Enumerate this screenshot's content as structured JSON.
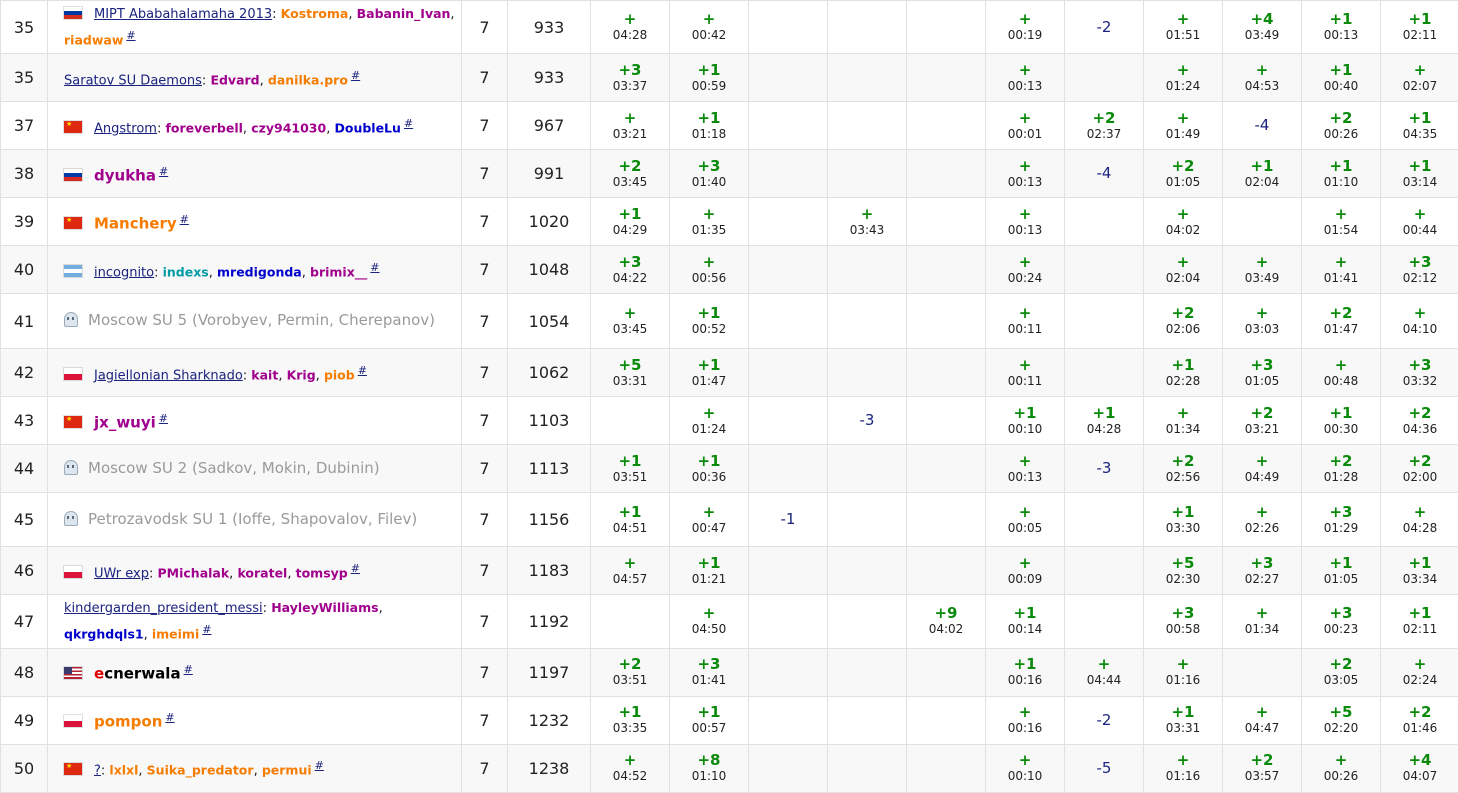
{
  "colors": {
    "accepted": "#0a8a0a",
    "rejected": "#1a237e",
    "team_link": "#1a237e",
    "orange": "#f57c00",
    "violet": "#a0008c",
    "blue": "#0000cc",
    "cyan": "#039ba6",
    "gray": "#9a9a9a"
  },
  "rows": [
    {
      "rank": "35",
      "flag": "ru",
      "team": "MIPT Ababahalamaha 2013",
      "style": "link",
      "members": [
        {
          "n": "Kostroma",
          "c": "orange"
        },
        {
          "n": "Babanin_Ivan",
          "c": "violet"
        },
        {
          "n": "riadwaw",
          "c": "orange"
        }
      ],
      "solved": "7",
      "penalty": "933",
      "cells": [
        {
          "r": "+",
          "t": "04:28"
        },
        {
          "r": "+",
          "t": "00:42"
        },
        null,
        null,
        null,
        {
          "r": "+",
          "t": "00:19"
        },
        {
          "r": "-2"
        },
        {
          "r": "+",
          "t": "01:51"
        },
        {
          "r": "+4",
          "t": "03:49"
        },
        {
          "r": "+1",
          "t": "00:13"
        },
        {
          "r": "+1",
          "t": "02:11"
        }
      ]
    },
    {
      "rank": "35",
      "flag": "",
      "team": "Saratov SU Daemons",
      "style": "link",
      "members": [
        {
          "n": "Edvard",
          "c": "violet"
        },
        {
          "n": "danilka.pro",
          "c": "orange"
        }
      ],
      "solved": "7",
      "penalty": "933",
      "cells": [
        {
          "r": "+3",
          "t": "03:37"
        },
        {
          "r": "+1",
          "t": "00:59"
        },
        null,
        null,
        null,
        {
          "r": "+",
          "t": "00:13"
        },
        null,
        {
          "r": "+",
          "t": "01:24"
        },
        {
          "r": "+",
          "t": "04:53"
        },
        {
          "r": "+1",
          "t": "00:40"
        },
        {
          "r": "+",
          "t": "02:07"
        }
      ]
    },
    {
      "rank": "37",
      "flag": "cn",
      "team": "Angstrom",
      "style": "link",
      "members": [
        {
          "n": "foreverbell",
          "c": "violet"
        },
        {
          "n": "czy941030",
          "c": "violet"
        },
        {
          "n": "DoubleLu",
          "c": "blue"
        }
      ],
      "solved": "7",
      "penalty": "967",
      "cells": [
        {
          "r": "+",
          "t": "03:21"
        },
        {
          "r": "+1",
          "t": "01:18"
        },
        null,
        null,
        null,
        {
          "r": "+",
          "t": "00:01"
        },
        {
          "r": "+2",
          "t": "02:37"
        },
        {
          "r": "+",
          "t": "01:49"
        },
        {
          "r": "-4"
        },
        {
          "r": "+2",
          "t": "00:26"
        },
        {
          "r": "+1",
          "t": "04:35"
        }
      ]
    },
    {
      "rank": "38",
      "flag": "ru",
      "team": "dyukha",
      "style": "violet",
      "members": [],
      "solved": "7",
      "penalty": "991",
      "cells": [
        {
          "r": "+2",
          "t": "03:45"
        },
        {
          "r": "+3",
          "t": "01:40"
        },
        null,
        null,
        null,
        {
          "r": "+",
          "t": "00:13"
        },
        {
          "r": "-4"
        },
        {
          "r": "+2",
          "t": "01:05"
        },
        {
          "r": "+1",
          "t": "02:04"
        },
        {
          "r": "+1",
          "t": "01:10"
        },
        {
          "r": "+1",
          "t": "03:14"
        }
      ]
    },
    {
      "rank": "39",
      "flag": "cn",
      "team": "Manchery",
      "style": "orange",
      "members": [],
      "solved": "7",
      "penalty": "1020",
      "cells": [
        {
          "r": "+1",
          "t": "04:29"
        },
        {
          "r": "+",
          "t": "01:35"
        },
        null,
        {
          "r": "+",
          "t": "03:43"
        },
        null,
        {
          "r": "+",
          "t": "00:13"
        },
        null,
        {
          "r": "+",
          "t": "04:02"
        },
        null,
        {
          "r": "+",
          "t": "01:54"
        },
        {
          "r": "+",
          "t": "00:44"
        }
      ]
    },
    {
      "rank": "40",
      "flag": "ar",
      "team": "incognito",
      "style": "link",
      "members": [
        {
          "n": "indexs",
          "c": "cyan"
        },
        {
          "n": "mredigonda",
          "c": "blue"
        },
        {
          "n": "brimix__",
          "c": "violet"
        }
      ],
      "solved": "7",
      "penalty": "1048",
      "cells": [
        {
          "r": "+3",
          "t": "04:22"
        },
        {
          "r": "+",
          "t": "00:56"
        },
        null,
        null,
        null,
        {
          "r": "+",
          "t": "00:24"
        },
        null,
        {
          "r": "+",
          "t": "02:04"
        },
        {
          "r": "+",
          "t": "03:49"
        },
        {
          "r": "+",
          "t": "01:41"
        },
        {
          "r": "+3",
          "t": "02:12"
        }
      ]
    },
    {
      "rank": "41",
      "flag": "ghost",
      "team": "Moscow SU 5 (Vorobyev, Permin, Cherepanov)",
      "style": "gray",
      "members": [],
      "solved": "7",
      "penalty": "1054",
      "cells": [
        {
          "r": "+",
          "t": "03:45"
        },
        {
          "r": "+1",
          "t": "00:52"
        },
        null,
        null,
        null,
        {
          "r": "+",
          "t": "00:11"
        },
        null,
        {
          "r": "+2",
          "t": "02:06"
        },
        {
          "r": "+",
          "t": "03:03"
        },
        {
          "r": "+2",
          "t": "01:47"
        },
        {
          "r": "+",
          "t": "04:10"
        }
      ]
    },
    {
      "rank": "42",
      "flag": "pl",
      "team": "Jagiellonian Sharknado",
      "style": "link",
      "members": [
        {
          "n": "kait",
          "c": "violet"
        },
        {
          "n": "Krig",
          "c": "violet"
        },
        {
          "n": "piob",
          "c": "orange"
        }
      ],
      "solved": "7",
      "penalty": "1062",
      "cells": [
        {
          "r": "+5",
          "t": "03:31"
        },
        {
          "r": "+1",
          "t": "01:47"
        },
        null,
        null,
        null,
        {
          "r": "+",
          "t": "00:11"
        },
        null,
        {
          "r": "+1",
          "t": "02:28"
        },
        {
          "r": "+3",
          "t": "01:05"
        },
        {
          "r": "+",
          "t": "00:48"
        },
        {
          "r": "+3",
          "t": "03:32"
        }
      ]
    },
    {
      "rank": "43",
      "flag": "cn",
      "team": "jx_wuyi",
      "style": "violet",
      "members": [],
      "solved": "7",
      "penalty": "1103",
      "cells": [
        null,
        {
          "r": "+",
          "t": "01:24"
        },
        null,
        {
          "r": "-3"
        },
        null,
        {
          "r": "+1",
          "t": "00:10"
        },
        {
          "r": "+1",
          "t": "04:28"
        },
        {
          "r": "+",
          "t": "01:34"
        },
        {
          "r": "+2",
          "t": "03:21"
        },
        {
          "r": "+1",
          "t": "00:30"
        },
        {
          "r": "+2",
          "t": "04:36"
        }
      ]
    },
    {
      "rank": "44",
      "flag": "ghost",
      "team": "Moscow SU 2 (Sadkov, Mokin, Dubinin)",
      "style": "gray",
      "members": [],
      "solved": "7",
      "penalty": "1113",
      "cells": [
        {
          "r": "+1",
          "t": "03:51"
        },
        {
          "r": "+1",
          "t": "00:36"
        },
        null,
        null,
        null,
        {
          "r": "+",
          "t": "00:13"
        },
        {
          "r": "-3"
        },
        {
          "r": "+2",
          "t": "02:56"
        },
        {
          "r": "+",
          "t": "04:49"
        },
        {
          "r": "+2",
          "t": "01:28"
        },
        {
          "r": "+2",
          "t": "02:00"
        }
      ]
    },
    {
      "rank": "45",
      "flag": "ghost",
      "team": "Petrozavodsk SU 1 (Ioffe, Shapovalov, Filev)",
      "style": "gray",
      "members": [],
      "solved": "7",
      "penalty": "1156",
      "cells": [
        {
          "r": "+1",
          "t": "04:51"
        },
        {
          "r": "+",
          "t": "00:47"
        },
        {
          "r": "-1"
        },
        null,
        null,
        {
          "r": "+",
          "t": "00:05"
        },
        null,
        {
          "r": "+1",
          "t": "03:30"
        },
        {
          "r": "+",
          "t": "02:26"
        },
        {
          "r": "+3",
          "t": "01:29"
        },
        {
          "r": "+",
          "t": "04:28"
        }
      ]
    },
    {
      "rank": "46",
      "flag": "pl",
      "team": "UWr exp",
      "style": "link",
      "members": [
        {
          "n": "PMichalak",
          "c": "violet"
        },
        {
          "n": "koratel",
          "c": "violet"
        },
        {
          "n": "tomsyp",
          "c": "violet"
        }
      ],
      "solved": "7",
      "penalty": "1183",
      "cells": [
        {
          "r": "+",
          "t": "04:57"
        },
        {
          "r": "+1",
          "t": "01:21"
        },
        null,
        null,
        null,
        {
          "r": "+",
          "t": "00:09"
        },
        null,
        {
          "r": "+5",
          "t": "02:30"
        },
        {
          "r": "+3",
          "t": "02:27"
        },
        {
          "r": "+1",
          "t": "01:05"
        },
        {
          "r": "+1",
          "t": "03:34"
        }
      ]
    },
    {
      "rank": "47",
      "flag": "",
      "team": "kindergarden_president_messi",
      "style": "link",
      "members": [
        {
          "n": "HayleyWilliams",
          "c": "violet"
        },
        {
          "n": "qkrghdqls1",
          "c": "blue"
        },
        {
          "n": "imeimi",
          "c": "orange"
        }
      ],
      "solved": "7",
      "penalty": "1192",
      "cells": [
        null,
        {
          "r": "+",
          "t": "04:50"
        },
        null,
        null,
        {
          "r": "+9",
          "t": "04:02"
        },
        {
          "r": "+1",
          "t": "00:14"
        },
        null,
        {
          "r": "+3",
          "t": "00:58"
        },
        {
          "r": "+",
          "t": "01:34"
        },
        {
          "r": "+3",
          "t": "00:23"
        },
        {
          "r": "+1",
          "t": "02:11"
        }
      ]
    },
    {
      "rank": "48",
      "flag": "us",
      "team": "ecnerwala",
      "style": "redfirst",
      "members": [],
      "solved": "7",
      "penalty": "1197",
      "cells": [
        {
          "r": "+2",
          "t": "03:51"
        },
        {
          "r": "+3",
          "t": "01:41"
        },
        null,
        null,
        null,
        {
          "r": "+1",
          "t": "00:16"
        },
        {
          "r": "+",
          "t": "04:44"
        },
        {
          "r": "+",
          "t": "01:16"
        },
        null,
        {
          "r": "+2",
          "t": "03:05"
        },
        {
          "r": "+",
          "t": "02:24"
        }
      ]
    },
    {
      "rank": "49",
      "flag": "pl",
      "team": "pompon",
      "style": "orange",
      "members": [],
      "solved": "7",
      "penalty": "1232",
      "cells": [
        {
          "r": "+1",
          "t": "03:35"
        },
        {
          "r": "+1",
          "t": "00:57"
        },
        null,
        null,
        null,
        {
          "r": "+",
          "t": "00:16"
        },
        {
          "r": "-2"
        },
        {
          "r": "+1",
          "t": "03:31"
        },
        {
          "r": "+",
          "t": "04:47"
        },
        {
          "r": "+5",
          "t": "02:20"
        },
        {
          "r": "+2",
          "t": "01:46"
        }
      ]
    },
    {
      "rank": "50",
      "flag": "cn",
      "team": "?",
      "style": "link",
      "members": [
        {
          "n": "lxlxl",
          "c": "orange"
        },
        {
          "n": "Suika_predator",
          "c": "orange"
        },
        {
          "n": "permui",
          "c": "orange"
        }
      ],
      "solved": "7",
      "penalty": "1238",
      "cells": [
        {
          "r": "+",
          "t": "04:52"
        },
        {
          "r": "+8",
          "t": "01:10"
        },
        null,
        null,
        null,
        {
          "r": "+",
          "t": "00:10"
        },
        {
          "r": "-5"
        },
        {
          "r": "+",
          "t": "01:16"
        },
        {
          "r": "+2",
          "t": "03:57"
        },
        {
          "r": "+",
          "t": "00:26"
        },
        {
          "r": "+4",
          "t": "04:07"
        }
      ]
    }
  ]
}
